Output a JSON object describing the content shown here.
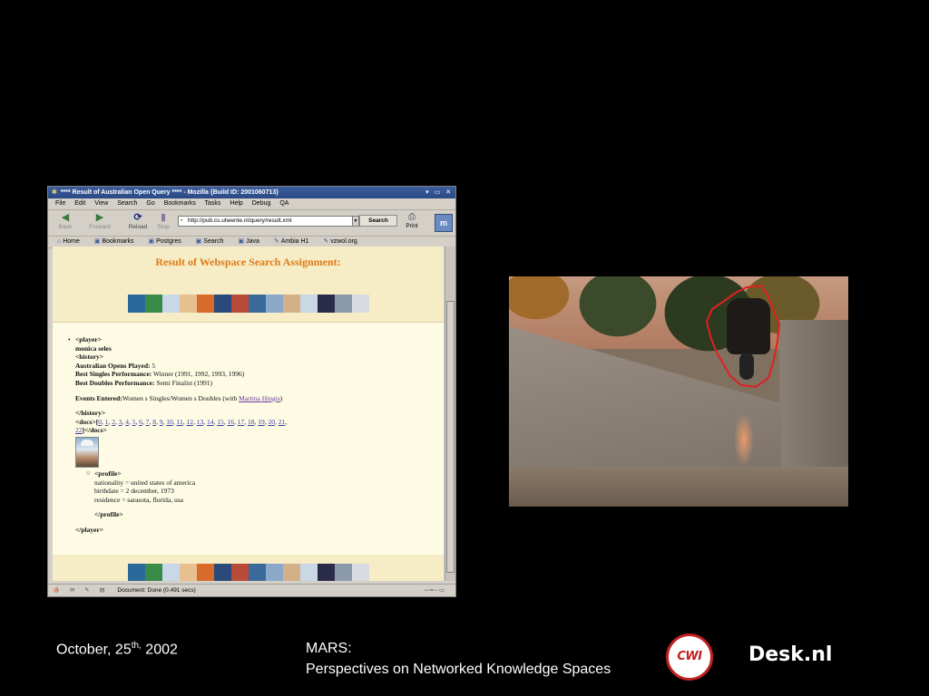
{
  "browser": {
    "title": "**** Result of Australian Open Query **** - Mozilla {Build ID: 2001060713}",
    "window_buttons": "▾ ▭ ✕",
    "menu": [
      "File",
      "Edit",
      "View",
      "Search",
      "Go",
      "Bookmarks",
      "Tasks",
      "Help",
      "Debug",
      "QA"
    ],
    "nav": {
      "back": "Back",
      "forward": "Forward",
      "reload": "Reload",
      "stop": "Stop",
      "search": "Search",
      "print": "Print"
    },
    "url": "http://pub.cs.utwente.nl/query/result.xml",
    "personal_toolbar": [
      "Home",
      "Bookmarks",
      "Postgres",
      "Search",
      "Java",
      "Ambia H1",
      "vzwol.org"
    ],
    "status": "Document: Done (0.491 secs)"
  },
  "page": {
    "heading": "Result of Webspace Search Assignment:",
    "strip_colors": [
      "#2a6a9a",
      "#3a8a4a",
      "#c8d8e8",
      "#e8c090",
      "#d86a2a",
      "#2a4a7a",
      "#b84a3a",
      "#3a6a9a",
      "#8aa8c8",
      "#d4b08a",
      "#c8d8e4",
      "#2a2a4a",
      "#8a9aaa",
      "#d8dce2"
    ],
    "xml": {
      "player_open": "<player>",
      "name": "monica seles",
      "history_open": "<history>",
      "opens_label": "Australian Opens Played:",
      "opens_value": "5",
      "singles_label": "Best Singles Performance:",
      "singles_value": "Winner (1991, 1992, 1993, 1996)",
      "doubles_label": "Best Doubles Performance:",
      "doubles_value": "Semi Finalist (1991)",
      "events_label": "Events Entered:",
      "events_value": "Women s Singles/Women s Doubles (with",
      "events_partner": "Martina Hingis",
      "events_close": ")",
      "history_close": "</history>",
      "docs_open": "<docs>[",
      "docs_links": [
        "0",
        "1",
        "2",
        "3",
        "4",
        "5",
        "6",
        "7",
        "8",
        "9",
        "10",
        "11",
        "12",
        "13",
        "14",
        "15",
        "16",
        "17",
        "18",
        "19",
        "20",
        "21",
        "22"
      ],
      "docs_close": "]</docs>",
      "profile_open": "<profile>",
      "nationality": "nationality = united states of america",
      "birthdate": "birthdate = 2 december, 1973",
      "residence": "residence = sarasota, florida, usa",
      "profile_close": "</profile>",
      "player_close": "</player>"
    }
  },
  "footer": {
    "date_prefix": "October, 25",
    "date_sup": "th,",
    "date_year": " 2002",
    "title": "MARS:",
    "subtitle": "Perspectives on Networked Knowledge Spaces",
    "logo_cwi": "CWI",
    "logo_desk": "Desk.nl"
  }
}
